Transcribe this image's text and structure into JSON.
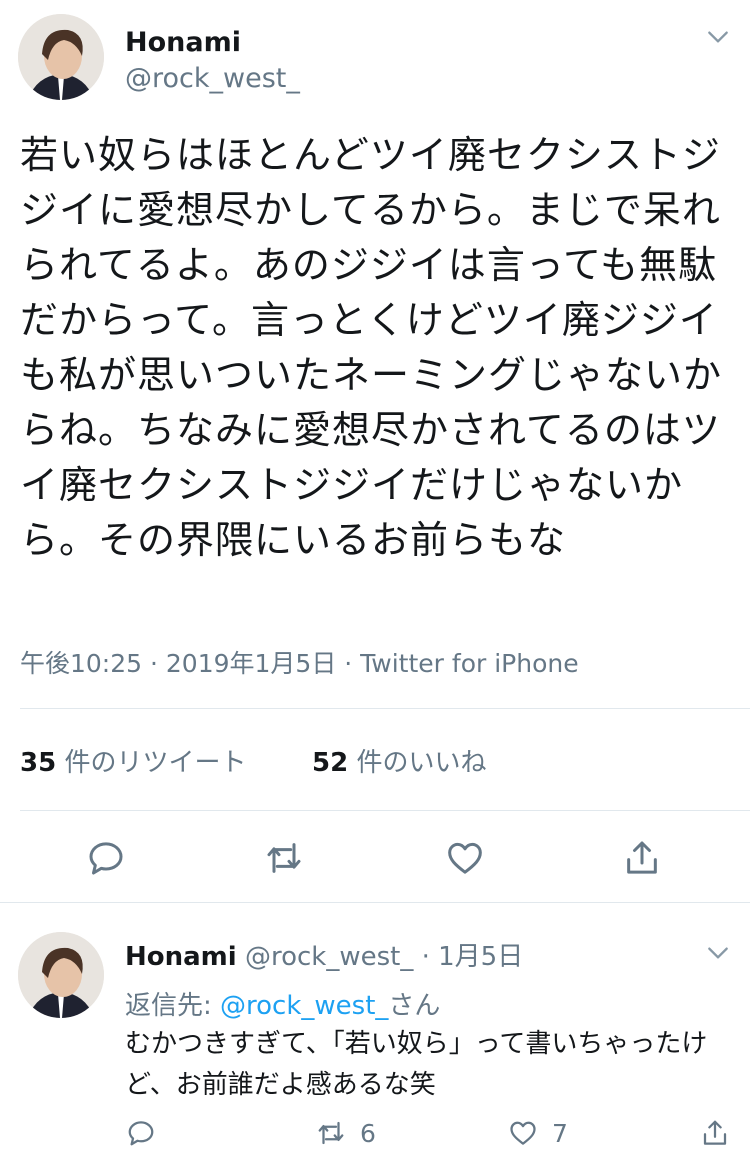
{
  "main_tweet": {
    "display_name": "Honami",
    "handle": "@rock_west_",
    "text": "若い奴らはほとんどツイ廃セクシストジジイに愛想尽かしてるから。まじで呆れられてるよ。あのジジイは言っても無駄だからって。言っとくけどツイ廃ジジイも私が思いついたネーミングじゃないからね。ちなみに愛想尽かされてるのはツイ廃セクシストジジイだけじゃないから。その界隈にいるお前らもな",
    "timestamp": "午後10:25 · 2019年1月5日 · Twitter for iPhone",
    "retweets": {
      "count": "35",
      "label": "件のリツイート"
    },
    "likes": {
      "count": "52",
      "label": "件のいいね"
    }
  },
  "reply_tweet": {
    "display_name": "Honami",
    "handle_date": "@rock_west_ · 1月5日",
    "replying_prefix": "返信先: ",
    "replying_mention": "@rock_west_",
    "replying_suffix": "さん",
    "text": "むかつきすぎて、「若い奴ら」って書いちゃったけど、お前誰だよ感あるな笑",
    "retweet_count": "6",
    "like_count": "7"
  },
  "icons": [
    "chevron-down-icon",
    "reply-icon",
    "retweet-icon",
    "like-icon",
    "share-icon"
  ],
  "colors": {
    "text": "#14171a",
    "secondary": "#657786",
    "link": "#1da1f2",
    "divider": "#e1e8ed"
  }
}
